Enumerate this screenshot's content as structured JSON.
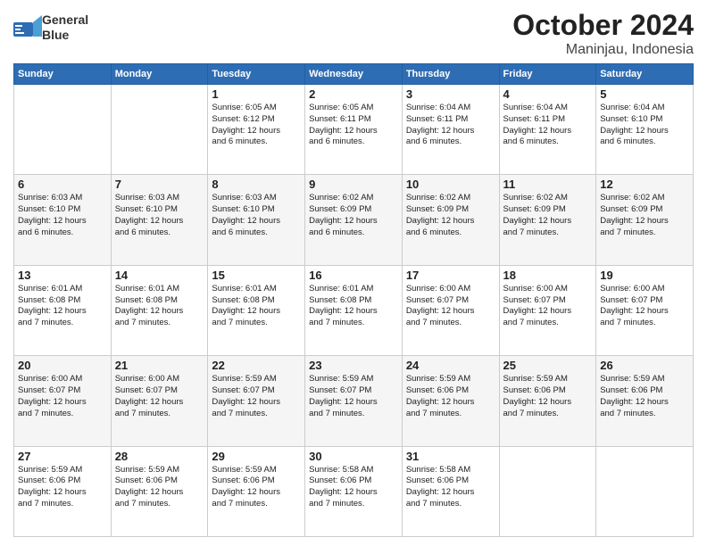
{
  "header": {
    "logo_line1": "General",
    "logo_line2": "Blue",
    "title": "October 2024",
    "subtitle": "Maninjau, Indonesia"
  },
  "calendar": {
    "weekdays": [
      "Sunday",
      "Monday",
      "Tuesday",
      "Wednesday",
      "Thursday",
      "Friday",
      "Saturday"
    ],
    "rows": [
      [
        {
          "day": "",
          "info": ""
        },
        {
          "day": "",
          "info": ""
        },
        {
          "day": "1",
          "info": "Sunrise: 6:05 AM\nSunset: 6:12 PM\nDaylight: 12 hours\nand 6 minutes."
        },
        {
          "day": "2",
          "info": "Sunrise: 6:05 AM\nSunset: 6:11 PM\nDaylight: 12 hours\nand 6 minutes."
        },
        {
          "day": "3",
          "info": "Sunrise: 6:04 AM\nSunset: 6:11 PM\nDaylight: 12 hours\nand 6 minutes."
        },
        {
          "day": "4",
          "info": "Sunrise: 6:04 AM\nSunset: 6:11 PM\nDaylight: 12 hours\nand 6 minutes."
        },
        {
          "day": "5",
          "info": "Sunrise: 6:04 AM\nSunset: 6:10 PM\nDaylight: 12 hours\nand 6 minutes."
        }
      ],
      [
        {
          "day": "6",
          "info": "Sunrise: 6:03 AM\nSunset: 6:10 PM\nDaylight: 12 hours\nand 6 minutes."
        },
        {
          "day": "7",
          "info": "Sunrise: 6:03 AM\nSunset: 6:10 PM\nDaylight: 12 hours\nand 6 minutes."
        },
        {
          "day": "8",
          "info": "Sunrise: 6:03 AM\nSunset: 6:10 PM\nDaylight: 12 hours\nand 6 minutes."
        },
        {
          "day": "9",
          "info": "Sunrise: 6:02 AM\nSunset: 6:09 PM\nDaylight: 12 hours\nand 6 minutes."
        },
        {
          "day": "10",
          "info": "Sunrise: 6:02 AM\nSunset: 6:09 PM\nDaylight: 12 hours\nand 6 minutes."
        },
        {
          "day": "11",
          "info": "Sunrise: 6:02 AM\nSunset: 6:09 PM\nDaylight: 12 hours\nand 7 minutes."
        },
        {
          "day": "12",
          "info": "Sunrise: 6:02 AM\nSunset: 6:09 PM\nDaylight: 12 hours\nand 7 minutes."
        }
      ],
      [
        {
          "day": "13",
          "info": "Sunrise: 6:01 AM\nSunset: 6:08 PM\nDaylight: 12 hours\nand 7 minutes."
        },
        {
          "day": "14",
          "info": "Sunrise: 6:01 AM\nSunset: 6:08 PM\nDaylight: 12 hours\nand 7 minutes."
        },
        {
          "day": "15",
          "info": "Sunrise: 6:01 AM\nSunset: 6:08 PM\nDaylight: 12 hours\nand 7 minutes."
        },
        {
          "day": "16",
          "info": "Sunrise: 6:01 AM\nSunset: 6:08 PM\nDaylight: 12 hours\nand 7 minutes."
        },
        {
          "day": "17",
          "info": "Sunrise: 6:00 AM\nSunset: 6:07 PM\nDaylight: 12 hours\nand 7 minutes."
        },
        {
          "day": "18",
          "info": "Sunrise: 6:00 AM\nSunset: 6:07 PM\nDaylight: 12 hours\nand 7 minutes."
        },
        {
          "day": "19",
          "info": "Sunrise: 6:00 AM\nSunset: 6:07 PM\nDaylight: 12 hours\nand 7 minutes."
        }
      ],
      [
        {
          "day": "20",
          "info": "Sunrise: 6:00 AM\nSunset: 6:07 PM\nDaylight: 12 hours\nand 7 minutes."
        },
        {
          "day": "21",
          "info": "Sunrise: 6:00 AM\nSunset: 6:07 PM\nDaylight: 12 hours\nand 7 minutes."
        },
        {
          "day": "22",
          "info": "Sunrise: 5:59 AM\nSunset: 6:07 PM\nDaylight: 12 hours\nand 7 minutes."
        },
        {
          "day": "23",
          "info": "Sunrise: 5:59 AM\nSunset: 6:07 PM\nDaylight: 12 hours\nand 7 minutes."
        },
        {
          "day": "24",
          "info": "Sunrise: 5:59 AM\nSunset: 6:06 PM\nDaylight: 12 hours\nand 7 minutes."
        },
        {
          "day": "25",
          "info": "Sunrise: 5:59 AM\nSunset: 6:06 PM\nDaylight: 12 hours\nand 7 minutes."
        },
        {
          "day": "26",
          "info": "Sunrise: 5:59 AM\nSunset: 6:06 PM\nDaylight: 12 hours\nand 7 minutes."
        }
      ],
      [
        {
          "day": "27",
          "info": "Sunrise: 5:59 AM\nSunset: 6:06 PM\nDaylight: 12 hours\nand 7 minutes."
        },
        {
          "day": "28",
          "info": "Sunrise: 5:59 AM\nSunset: 6:06 PM\nDaylight: 12 hours\nand 7 minutes."
        },
        {
          "day": "29",
          "info": "Sunrise: 5:59 AM\nSunset: 6:06 PM\nDaylight: 12 hours\nand 7 minutes."
        },
        {
          "day": "30",
          "info": "Sunrise: 5:58 AM\nSunset: 6:06 PM\nDaylight: 12 hours\nand 7 minutes."
        },
        {
          "day": "31",
          "info": "Sunrise: 5:58 AM\nSunset: 6:06 PM\nDaylight: 12 hours\nand 7 minutes."
        },
        {
          "day": "",
          "info": ""
        },
        {
          "day": "",
          "info": ""
        }
      ]
    ]
  }
}
